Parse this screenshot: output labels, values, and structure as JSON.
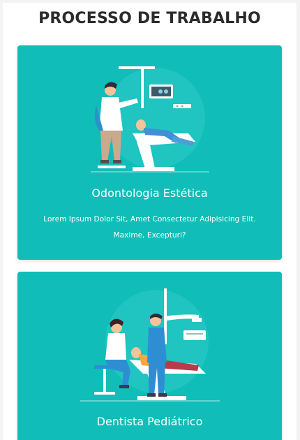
{
  "section": {
    "title": "PROCESSO DE TRABALHO"
  },
  "cards": [
    {
      "title": "Odontologia Estética",
      "text": "Lorem Ipsum Dolor Sit, Amet Consectetur Adipisicing Elit. Maxime, Excepturi?",
      "illustration": "dentist-treating-patient-illustration"
    },
    {
      "title": "Dentista Pediátrico",
      "illustration": "pediatric-dentist-illustration"
    }
  ],
  "colors": {
    "card": "#10bdb8",
    "title": "#2b2b2b",
    "card_text": "#ffffff"
  }
}
